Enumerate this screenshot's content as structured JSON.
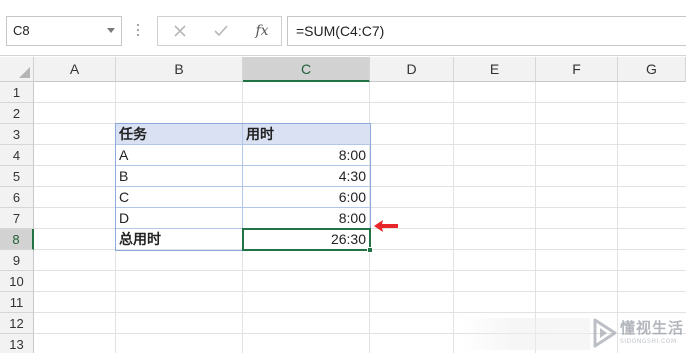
{
  "formula_bar": {
    "name_box": "C8",
    "formula": "=SUM(C4:C7)",
    "cancel_icon": "close-icon",
    "enter_icon": "check-icon",
    "fx_label": "fx"
  },
  "columns": [
    "A",
    "B",
    "C",
    "D",
    "E",
    "F",
    "G"
  ],
  "rows": [
    "1",
    "2",
    "3",
    "4",
    "5",
    "6",
    "7",
    "8",
    "9",
    "10",
    "11",
    "12",
    "13"
  ],
  "selected_cell": "C8",
  "table": {
    "header": {
      "task": "任务",
      "time": "用时"
    },
    "rows": [
      {
        "task": "A",
        "time": "8:00"
      },
      {
        "task": "B",
        "time": "4:30"
      },
      {
        "task": "C",
        "time": "6:00"
      },
      {
        "task": "D",
        "time": "8:00"
      }
    ],
    "total": {
      "label": "总用时",
      "time": "26:30"
    }
  },
  "annotation": {
    "arrow_color": "#e8262a"
  },
  "watermark": {
    "text": "懂视生活",
    "sub": "SIDONGSHI.COM"
  },
  "colors": {
    "accent_green": "#217346",
    "table_header": "#d9e1f2",
    "table_border": "#8ea9db"
  }
}
